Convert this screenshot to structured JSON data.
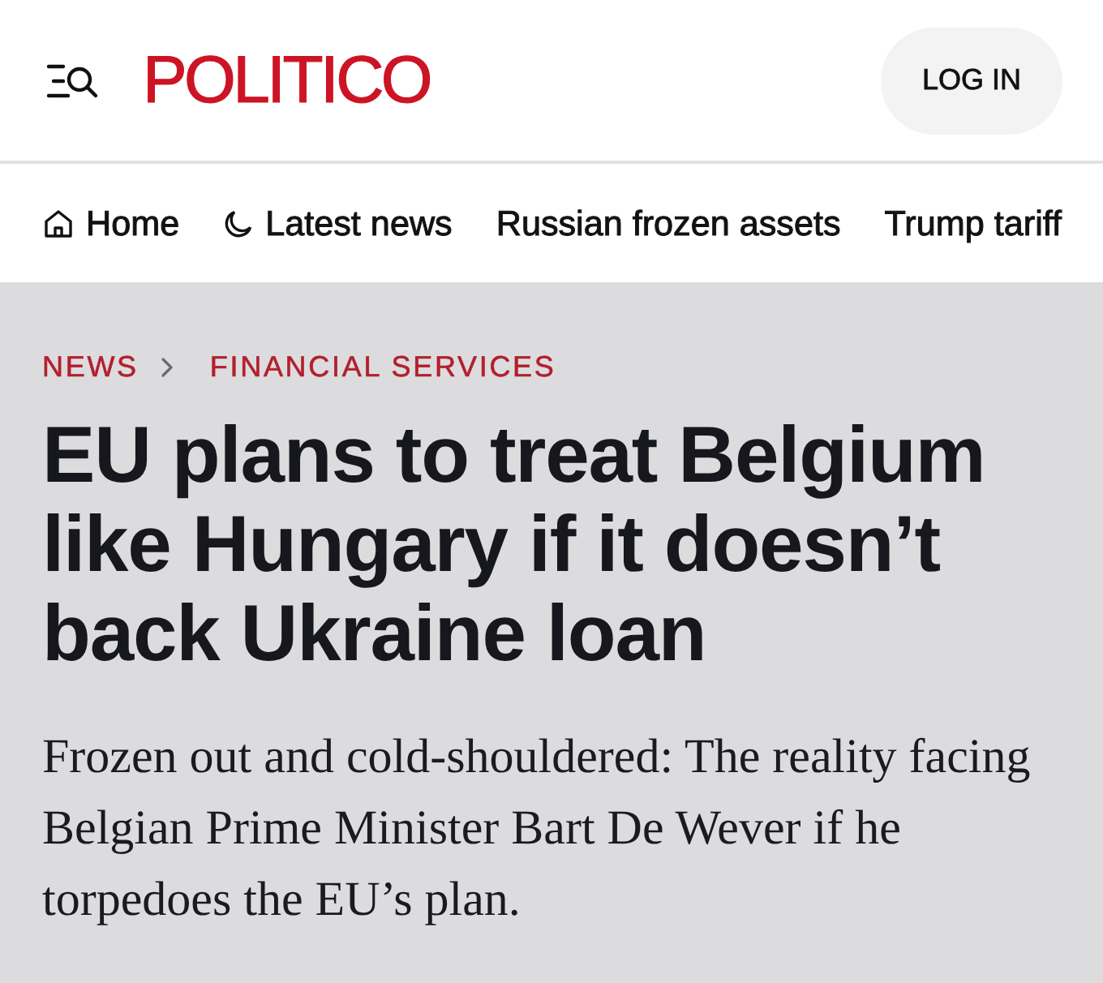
{
  "header": {
    "logo": "POLITICO",
    "login_button": "LOG IN"
  },
  "nav": {
    "items": [
      {
        "label": "Home",
        "kind": "home"
      },
      {
        "label": "Latest news",
        "kind": "latest"
      },
      {
        "label": "Russian frozen assets",
        "kind": "topic"
      },
      {
        "label": "Trump tariff",
        "kind": "topic"
      }
    ]
  },
  "article": {
    "breadcrumb": [
      "NEWS",
      "FINANCIAL SERVICES"
    ],
    "headline": "EU plans to treat Belgium like Hungary if it doesn’t back Ukraine loan",
    "dek": "Frozen out and cold-shouldered: The reality facing Belgian Prime Minister Bart De Wever if he torpedoes the EU’s plan."
  }
}
